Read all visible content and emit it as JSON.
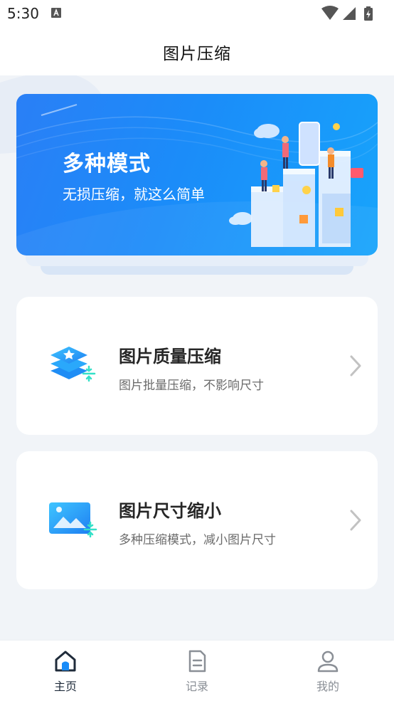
{
  "status_bar": {
    "time": "5:30"
  },
  "header": {
    "title": "图片压缩"
  },
  "banner": {
    "title": "多种模式",
    "subtitle": "无损压缩，就这么简单"
  },
  "cards": [
    {
      "title": "图片质量压缩",
      "desc": "图片批量压缩，不影响尺寸",
      "icon": "layers-star-icon"
    },
    {
      "title": "图片尺寸缩小",
      "desc": "多种压缩模式，减小图片尺寸",
      "icon": "image-resize-icon"
    }
  ],
  "tabs": [
    {
      "label": "主页",
      "icon": "home-icon",
      "active": true
    },
    {
      "label": "记录",
      "icon": "document-icon",
      "active": false
    },
    {
      "label": "我的",
      "icon": "profile-icon",
      "active": false
    }
  ],
  "colors": {
    "accent": "#1a8cf8",
    "tab_active": "#1f2b3a",
    "tab_inactive": "#8a8f96"
  }
}
